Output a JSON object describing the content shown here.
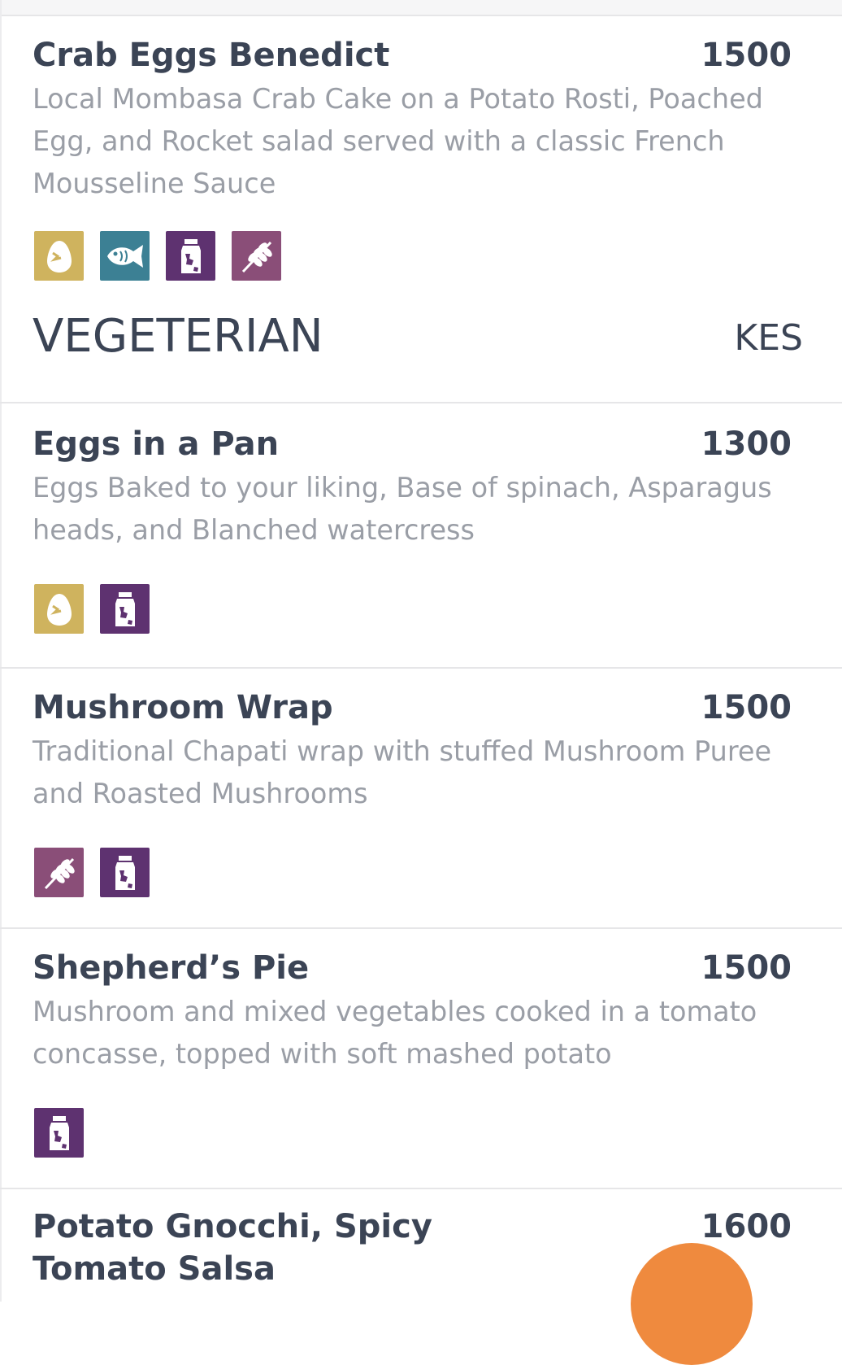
{
  "items_top": {
    "name": "Crab Eggs Benedict",
    "price": "1500",
    "description": "Local Mombasa Crab Cake on a Potato Rosti, Poached Egg, and Rocket salad served with a classic French Mousseline Sauce",
    "icons": [
      "egg-icon",
      "fish-icon",
      "dairy-icon",
      "gluten-icon"
    ]
  },
  "section": {
    "title": "VEGETERIAN",
    "currency": "KES"
  },
  "items": [
    {
      "name": "Eggs in a Pan",
      "price": "1300",
      "description": "Eggs Baked to your liking, Base of spinach, Asparagus heads, and Blanched watercress",
      "icons": [
        "egg-icon",
        "dairy-icon"
      ]
    },
    {
      "name": "Mushroom Wrap",
      "price": "1500",
      "description": "Traditional Chapati wrap with stuffed Mushroom Puree and Roasted Mushrooms",
      "icons": [
        "gluten-icon",
        "dairy-icon"
      ]
    },
    {
      "name": "Shepherd’s Pie",
      "price": "1500",
      "description": "Mushroom and mixed vegetables cooked in a tomato concasse, topped with soft mashed potato",
      "icons": [
        "dairy-icon"
      ]
    },
    {
      "name": "Potato Gnocchi, Spicy\nTomato Salsa",
      "price": "1600"
    }
  ],
  "colors": {
    "egg": "#cfb35e",
    "fish": "#3c8094",
    "dairy": "#5e3270",
    "gluten": "#8a4e78",
    "fab": "#ef8a3e",
    "text_dark": "#3b4455",
    "text_muted": "#9a9ea6"
  }
}
